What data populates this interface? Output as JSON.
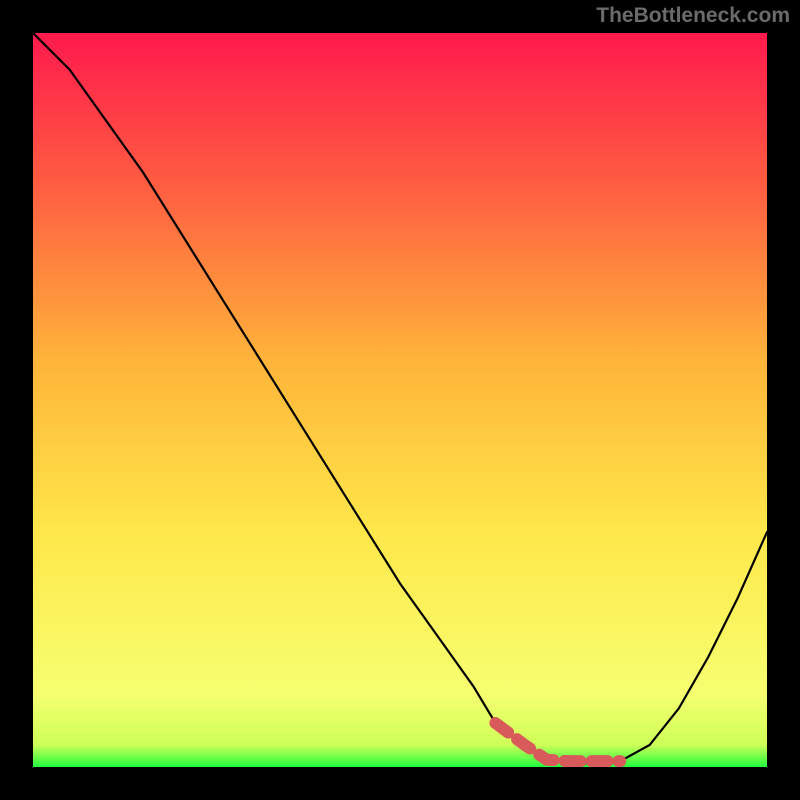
{
  "attribution": "TheBottleneck.com",
  "colors": {
    "page_bg": "#000000",
    "gradient_top": "#ff1a4d",
    "gradient_mid_upper": "#ff6a3a",
    "gradient_mid": "#ffd24a",
    "gradient_lower": "#f8ff6a",
    "gradient_bottom": "#2dff4a",
    "curve": "#000000",
    "accent": "#d85a5a"
  },
  "chart_data": {
    "type": "line",
    "title": "",
    "xlabel": "",
    "ylabel": "",
    "xlim": [
      0,
      100
    ],
    "ylim": [
      0,
      100
    ],
    "grid": false,
    "legend": false,
    "series": [
      {
        "name": "bottleneck-curve",
        "x": [
          0,
          5,
          10,
          15,
          20,
          25,
          30,
          35,
          40,
          45,
          50,
          55,
          60,
          63,
          67,
          70,
          73,
          76,
          80,
          84,
          88,
          92,
          96,
          100
        ],
        "values": [
          100,
          95,
          88,
          81,
          73,
          65,
          57,
          49,
          41,
          33,
          25,
          18,
          11,
          6,
          3,
          1,
          0.5,
          0.5,
          0.8,
          3,
          8,
          15,
          23,
          32
        ]
      }
    ],
    "accent_region": {
      "name": "optimal-zone",
      "x_start": 63,
      "x_end": 80,
      "y_level": 0.8
    },
    "annotations": []
  }
}
